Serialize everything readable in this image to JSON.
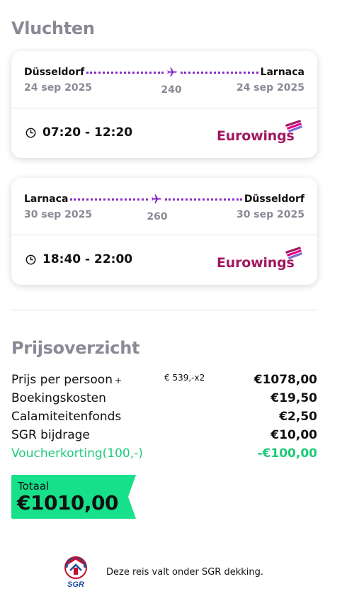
{
  "flights_section": {
    "title": "Vluchten"
  },
  "flights": [
    {
      "from": "Düsseldorf",
      "to": "Larnaca",
      "depart_date": "24 sep 2025",
      "arrive_date": "24 sep 2025",
      "flight_number": "240",
      "time": "07:20 - 12:20",
      "airline": "Eurowings"
    },
    {
      "from": "Larnaca",
      "to": "Düsseldorf",
      "depart_date": "30 sep 2025",
      "arrive_date": "30 sep 2025",
      "flight_number": "260",
      "time": "18:40 - 22:00",
      "airline": "Eurowings"
    }
  ],
  "price_section": {
    "title": "Prijsoverzicht",
    "rows": [
      {
        "label": "Prijs per persoon",
        "plus": "+",
        "sub": "€ 539,-x2",
        "value": "€1078,00"
      },
      {
        "label": "Boekingskosten",
        "value": "€19,50"
      },
      {
        "label": "Calamiteitenfonds",
        "value": "€2,50"
      },
      {
        "label": "SGR bijdrage",
        "value": "€10,00"
      },
      {
        "label": "Voucherkorting(100,-)",
        "value": "-€100,00"
      }
    ],
    "total_label": "Totaal",
    "total_value": "€1010,00"
  },
  "sgr": {
    "logo_text": "SGR",
    "text": "Deze reis valt onder SGR dekking."
  },
  "colors": {
    "route_dots": "#8a2cc7",
    "airline_brand": "#a0185f",
    "voucher_green": "#1ec97a",
    "total_bg": "#16e08a",
    "section_title_gray": "#8a8a96"
  },
  "icons": {
    "route": "plane-icon",
    "time": "clock-icon",
    "airline_mark": "eurowings-logo-mark",
    "sgr": "sgr-logo"
  }
}
